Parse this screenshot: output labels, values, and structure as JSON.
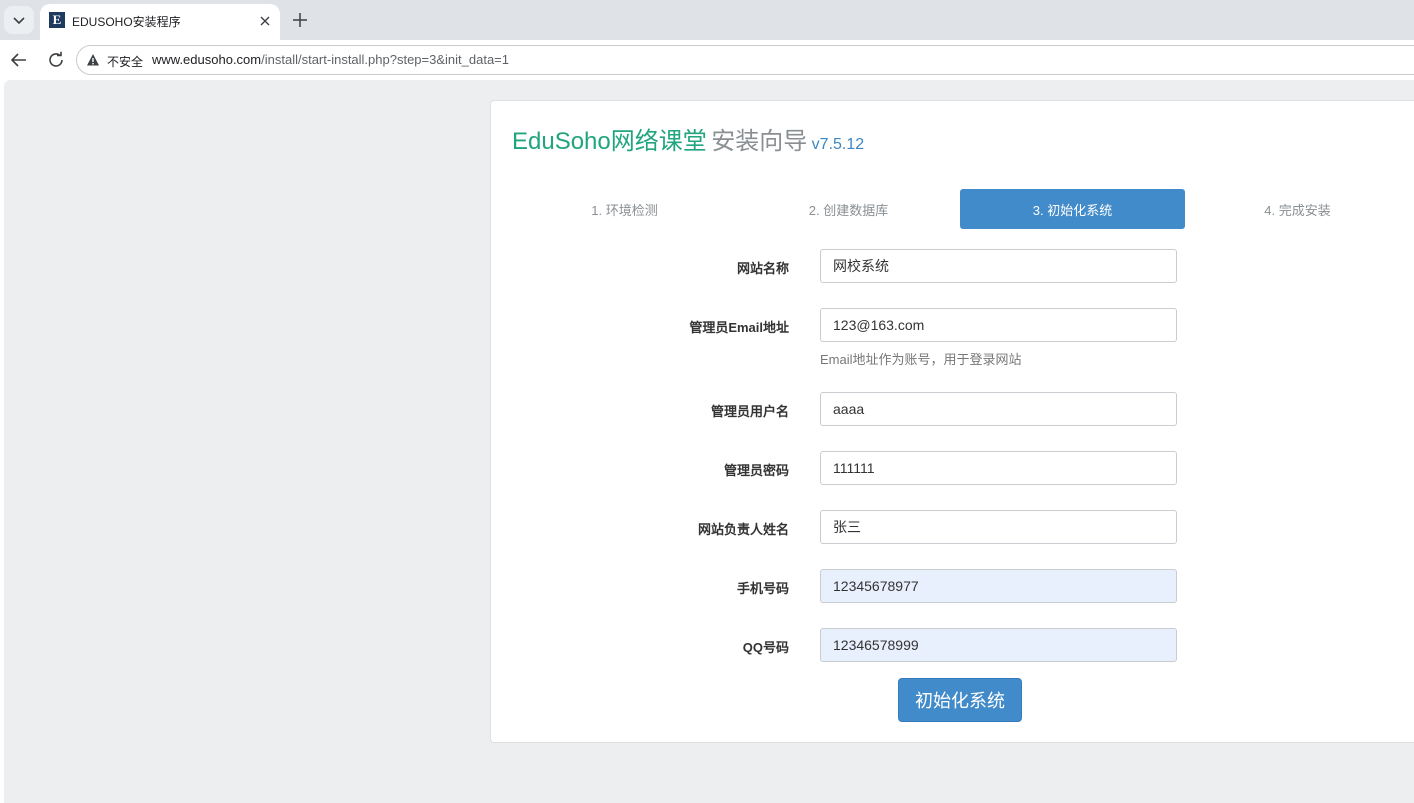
{
  "browser": {
    "tab_title": "EDUSOHO安装程序",
    "favicon_letter": "E",
    "security_label": "不安全",
    "url_host": "www.edusoho.com",
    "url_path": "/install/start-install.php?step=3&init_data=1"
  },
  "page": {
    "brand": "EduSoho网络课堂",
    "wizard": "安装向导",
    "version": "v7.5.12",
    "steps": [
      {
        "label": "1. 环境检测",
        "active": false
      },
      {
        "label": "2. 创建数据库",
        "active": false
      },
      {
        "label": "3. 初始化系统",
        "active": true
      },
      {
        "label": "4. 完成安装",
        "active": false
      }
    ],
    "form": {
      "site_name": {
        "label": "网站名称",
        "value": "网校系统"
      },
      "admin_email": {
        "label": "管理员Email地址",
        "value": "123@163.com",
        "help": "Email地址作为账号，用于登录网站"
      },
      "admin_username": {
        "label": "管理员用户名",
        "value": "aaaa"
      },
      "admin_password": {
        "label": "管理员密码",
        "value": "111111"
      },
      "owner_name": {
        "label": "网站负责人姓名",
        "value": "张三"
      },
      "mobile": {
        "label": "手机号码",
        "value": "12345678977"
      },
      "qq": {
        "label": "QQ号码",
        "value": "12346578999"
      }
    },
    "submit_label": "初始化系统"
  },
  "colors": {
    "brand_green": "#21a57e",
    "primary_blue": "#428bca",
    "autofill_bg": "#e8f0fe"
  }
}
